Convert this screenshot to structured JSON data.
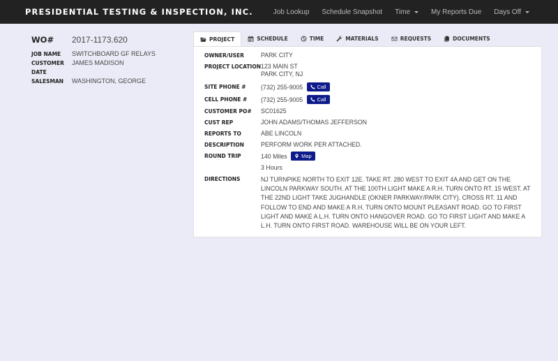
{
  "navbar": {
    "brand": "PRESIDENTIAL TESTING & INSPECTION, INC.",
    "items": [
      {
        "label": "Job Lookup",
        "dropdown": false
      },
      {
        "label": "Schedule Snapshot",
        "dropdown": false
      },
      {
        "label": "Time",
        "dropdown": true
      },
      {
        "label": "My Reports Due",
        "dropdown": false
      },
      {
        "label": "Days Off",
        "dropdown": true
      }
    ]
  },
  "summary": {
    "wo_label": "WO#",
    "wo_value": "2017-1173.620",
    "fields": [
      {
        "label": "JOB NAME",
        "value": "SWITCHBOARD GF RELAYS"
      },
      {
        "label": "CUSTOMER",
        "value": "JAMES MADISON"
      },
      {
        "label": "DATE",
        "value": ""
      },
      {
        "label": "SALESMAN",
        "value": "WASHINGTON, GEORGE"
      }
    ]
  },
  "tabs": [
    {
      "label": "PROJECT",
      "icon": "folder-open-icon",
      "active": true
    },
    {
      "label": "SCHEDULE",
      "icon": "calendar-icon",
      "active": false
    },
    {
      "label": "TIME",
      "icon": "clock-icon",
      "active": false
    },
    {
      "label": "MATERIALS",
      "icon": "wrench-icon",
      "active": false
    },
    {
      "label": "REQUESTS",
      "icon": "envelope-icon",
      "active": false
    },
    {
      "label": "DOCUMENTS",
      "icon": "documents-icon",
      "active": false
    }
  ],
  "project": {
    "owner_label": "OWNER/USER",
    "owner_value": "PARK CITY",
    "location_label": "PROJECT LOCATION",
    "location_line1": "123 MAIN ST",
    "location_line2": "PARK CITY, NJ",
    "site_phone_label": "SITE PHONE #",
    "site_phone_value": "(732) 255-9005",
    "cell_phone_label": "CELL PHONE #",
    "cell_phone_value": "(732) 255-9005",
    "call_label": "Call",
    "po_label": "CUSTOMER PO#",
    "po_value": "SC01625",
    "rep_label": "CUST REP",
    "rep_value": "JOHN ADAMS/THOMAS JEFFERSON",
    "reports_label": "REPORTS TO",
    "reports_value": "ABE LINCOLN",
    "description_label": "DESCRIPTION",
    "description_value": "PERFORM WORK PER ATTACHED.",
    "trip_label": "ROUND TRIP",
    "trip_miles": "140 Miles",
    "map_label": "Map",
    "trip_hours": "3 Hours",
    "directions_label": "DIRECTIONS",
    "directions_value": "NJ TURNPIKE NORTH TO EXIT 12E. TAKE RT. 280 WEST TO EXIT 4A AND GET ON THE LINCOLN PARKWAY SOUTH. AT THE 100TH LIGHT MAKE A R.H. TURN ONTO RT. 15 WEST. AT THE 22ND LIGHT TAKE JUGHANDLE (OKNER PARKWAY/PARK CITY). CROSS RT. 11 AND FOLLOW TO END AND MAKE A R.H. TURN ONTO MOUNT PLEASANT ROAD. GO TO FIRST LIGHT AND MAKE A L.H. TURN ONTO HANGOVER ROAD. GO TO FIRST LIGHT AND MAKE A L.H. TURN ONTO FIRST ROAD. WAREHOUSE WILL BE ON YOUR LEFT."
  },
  "colors": {
    "navbar_bg": "#222222",
    "page_bg": "#ebebf7",
    "button_bg": "#0e1b8a"
  }
}
